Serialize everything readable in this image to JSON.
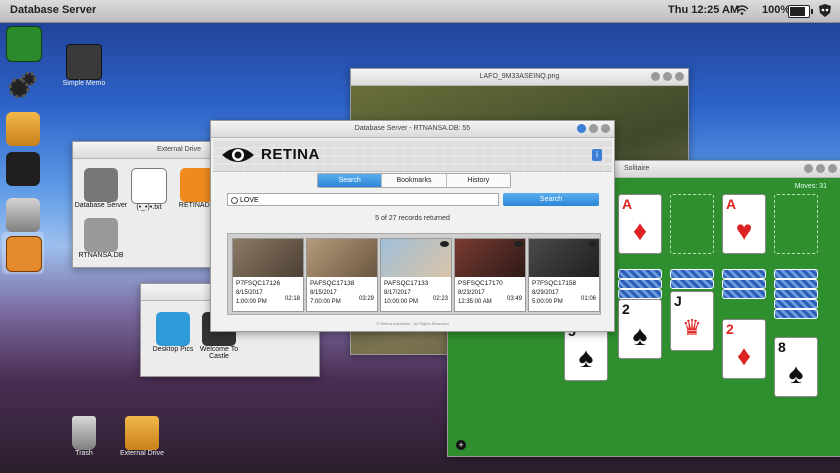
{
  "menubar": {
    "app_title": "Database Server",
    "clock": "Thu 12:25 AM",
    "battery": "100%"
  },
  "dock": {
    "items": [
      "solitaire-icon",
      "gear-icon",
      "drive-icon",
      "eye-icon",
      "trash-icon",
      "photo-icon"
    ]
  },
  "desktop": {
    "simple_memo": "Simple Memo",
    "trash": "Trash",
    "external_drive": "External Drive"
  },
  "photo_window": {
    "title": "LAFO_9M33ASEINQ.png"
  },
  "external_window": {
    "title": "External Drive",
    "items": [
      "Database Server",
      "(•_•)•.txt",
      "RETINADO",
      "RTNANSA.DB"
    ]
  },
  "desk_window": {
    "items": [
      "Desktop Pics",
      "Welcome To Castle"
    ]
  },
  "solitaire": {
    "title": "Solitaire",
    "moves": "Moves: 31"
  },
  "retina": {
    "title": "Database Server - RTNANSA.DB: 55",
    "logo": "RETINA",
    "tabs": [
      "Search",
      "Bookmarks",
      "History"
    ],
    "search_value": "LOVE",
    "search_button": "Search",
    "records": "5 of 27 records returned",
    "copyright": "© Retina Industries - All Rights Reserved",
    "results": [
      {
        "id": "P7FSQC17126",
        "date": "8/15/2017",
        "time": "1:00:00 PM",
        "duration": "02:18"
      },
      {
        "id": "PAFSQC17138",
        "date": "8/15/2017",
        "time": "7:00:00 PM",
        "duration": "03:29"
      },
      {
        "id": "PAFSQC17133",
        "date": "8/17/2017",
        "time": "10:00:00 PM",
        "duration": "02:23"
      },
      {
        "id": "PSFSQC17170",
        "date": "8/23/2017",
        "time": "12:35:00 AM",
        "duration": "03:49"
      },
      {
        "id": "P7FSQC17158",
        "date": "8/29/2017",
        "time": "5:00:00 PM",
        "duration": "01:06"
      }
    ]
  },
  "colors": {
    "accent": "#2d86d6",
    "felt": "#2f8f2f"
  }
}
